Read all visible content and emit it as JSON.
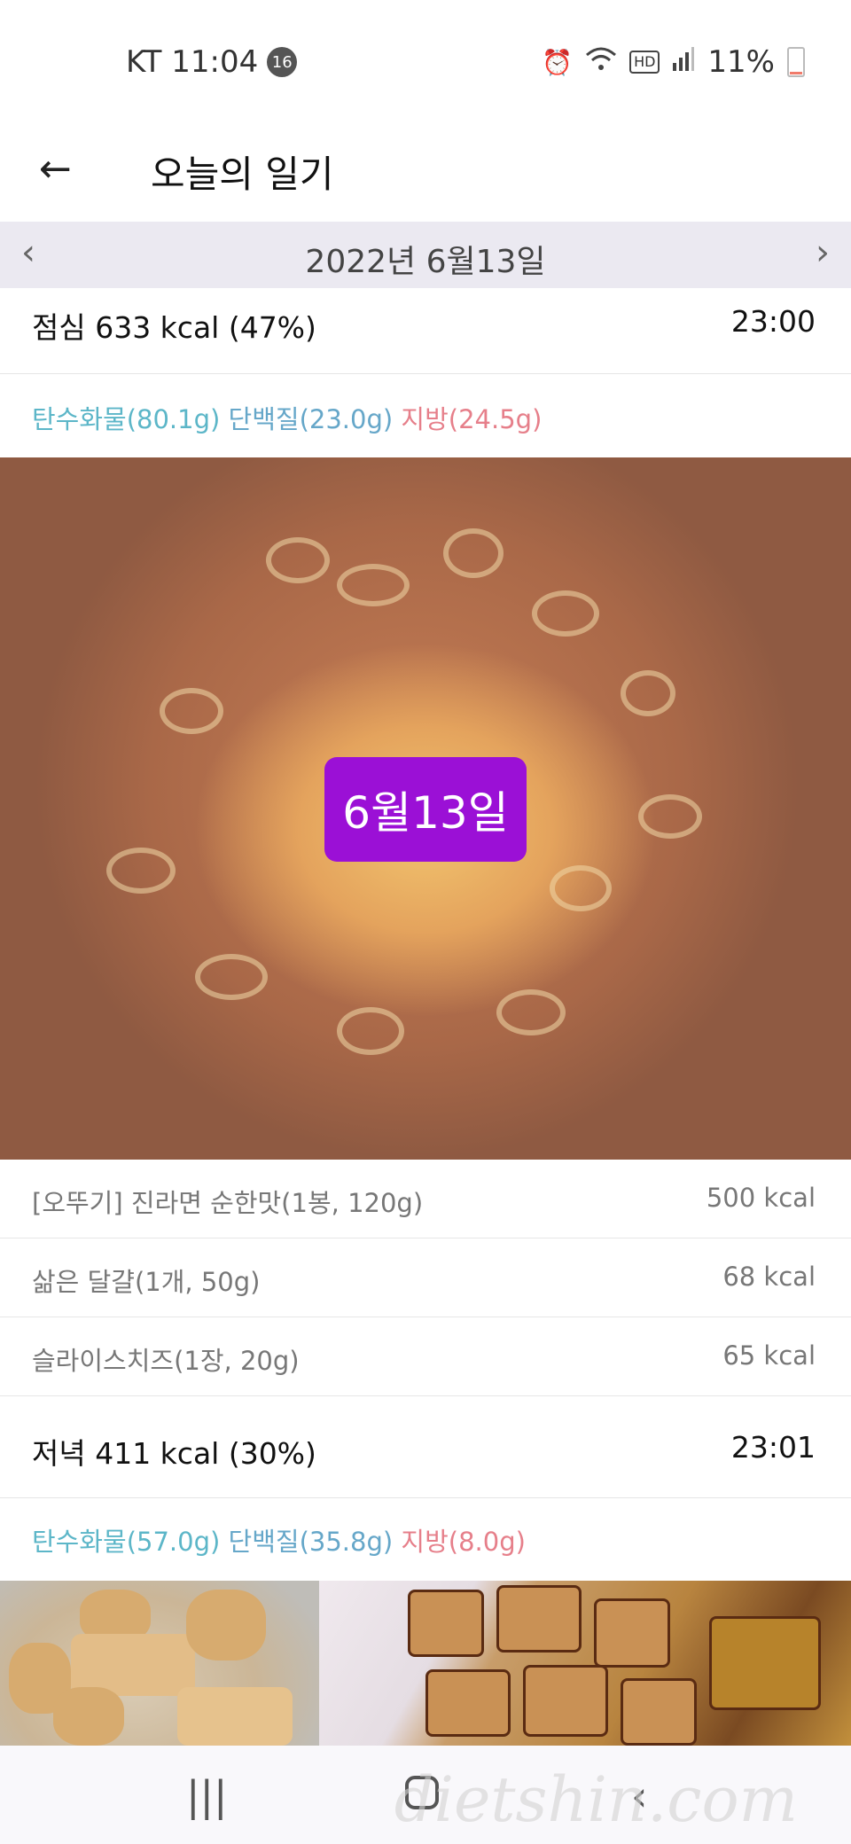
{
  "status_bar": {
    "carrier_time": "KT 11:04",
    "notification_count": "16",
    "hd_label": "HD",
    "battery": "11%",
    "battery_level": 0.11
  },
  "header": {
    "title": "오늘의 일기"
  },
  "date_nav": {
    "date": "2022년 6월13일"
  },
  "lunch": {
    "title": "점심 633 kcal (47%)",
    "time": "23:00",
    "carb": "탄수화물(80.1g)",
    "protein": "단백질(23.0g)",
    "fat": "지방(24.5g)",
    "photo_stamp": "6월13일",
    "items": [
      {
        "name": "[오뚜기] 진라면 순한맛(1봉, 120g)",
        "kcal": "500 kcal"
      },
      {
        "name": "삶은 달걀(1개, 50g)",
        "kcal": "68 kcal"
      },
      {
        "name": "슬라이스치즈(1장, 20g)",
        "kcal": "65 kcal"
      }
    ]
  },
  "dinner": {
    "title": "저녁 411 kcal (30%)",
    "time": "23:01",
    "carb": "탄수화물(57.0g)",
    "protein": "단백질(35.8g)",
    "fat": "지방(8.0g)"
  },
  "watermark": "dietshin.com",
  "colors": {
    "carb": "#5cb6c8",
    "protein": "#66a7c9",
    "fat": "#e67f8a",
    "date_stamp": "#9b10d6",
    "date_bar": "#ebe9f1"
  }
}
